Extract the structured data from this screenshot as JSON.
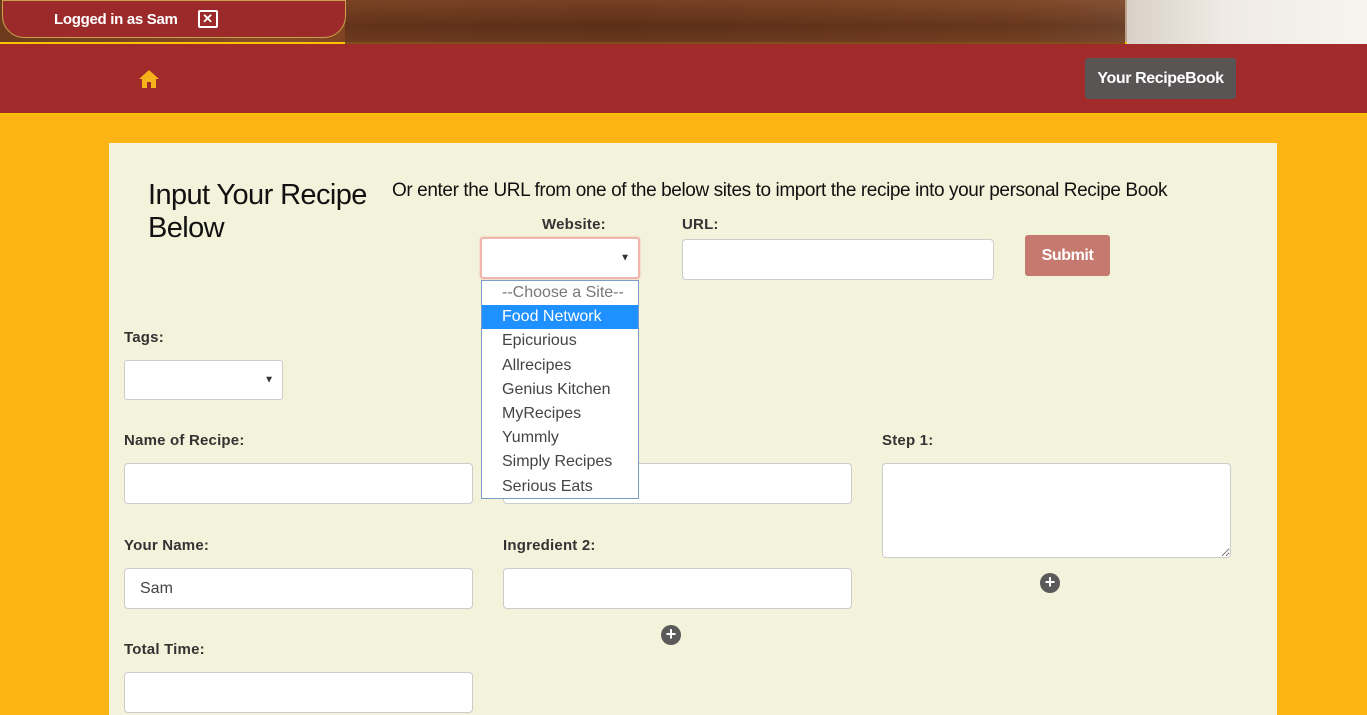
{
  "header": {
    "login_text": "Logged in as Sam",
    "close_glyph": "✕",
    "recipebook_label": "Your RecipeBook"
  },
  "form": {
    "title": "Input Your Recipe Below",
    "import_text": "Or enter the URL from one of the below sites to import the recipe into your personal Recipe Book",
    "website_label": "Website:",
    "url_label": "URL:",
    "submit_label": "Submit",
    "tags_label": "Tags:",
    "recipe_name_label": "Name of Recipe:",
    "your_name_label": "Your Name:",
    "your_name_value": "Sam",
    "total_time_label": "Total Time:",
    "ingredient2_label": "Ingredient 2:",
    "step1_label": "Step 1:"
  },
  "website_options": [
    "--Choose a Site--",
    "Food Network",
    "Epicurious",
    "Allrecipes",
    "Genius Kitchen",
    "MyRecipes",
    "Yummly",
    "Simply Recipes",
    "Serious Eats"
  ],
  "icons": {
    "home": "home-icon",
    "add": "plus-circle-icon",
    "caret": "caret-down-icon"
  },
  "colors": {
    "page_bg": "#fdb515",
    "navbar": "#a12a2a",
    "card_bg": "#f3f3dc",
    "submit": "#c67a6f",
    "recipebook_btn": "#5a5555",
    "highlight": "#1e90ff"
  }
}
